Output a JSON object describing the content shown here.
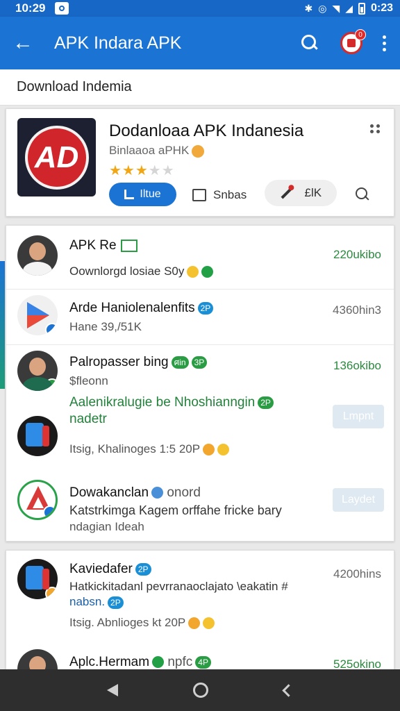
{
  "status": {
    "time_left": "10:29",
    "time_right": "0:23"
  },
  "appbar": {
    "title": "APK Indara APK",
    "badge": "0"
  },
  "subheader": {
    "text": "Download Indemia"
  },
  "featured": {
    "title": "Dodanloaa APK Indanesia",
    "subtitle": "Binlaaoa aPHK",
    "stars_on": "★★★",
    "stars_off": "★★",
    "install_label": "Iltue",
    "share_label": "Snbas",
    "tool_label": "£lK",
    "logo_text": "AD"
  },
  "items": [
    {
      "title": "APK Re",
      "sub": "Oownlorgd losiae S0y",
      "size": "220ukibo"
    },
    {
      "title": "Arde Haniolenalenfits",
      "pill": "2P",
      "sub": "Hane 39,/51K",
      "size": "4360hin3"
    },
    {
      "title": "Palropasser bing",
      "pill1": "ศin",
      "pill2": "3P",
      "sub": "$fleonn",
      "size": "136okibo"
    },
    {
      "title": "Aalenikralugie be Nhoshianngin",
      "title2": "nadetr",
      "pill": "2P",
      "sub": "Itsig, Khalinoges 1:5 20P",
      "btn": "Lmpnt"
    },
    {
      "title": "Dowakanclan",
      "tag": "onord",
      "sub": "Katstrkimga Kagem orffahe fricke bary",
      "sub2": "ndagian Ideah",
      "btn": "Laydet"
    },
    {
      "title": "Kaviedafer",
      "pill": "2P",
      "sub": "Hatkickitadanl pevrranaoclajato \\eakatin #",
      "sub2": "nabsn.",
      "sub3": "Itsig. Abnlioges kt 20P",
      "size": "4200hins"
    },
    {
      "title": "Aplc.Hermam",
      "tag": "npfc",
      "pill": "4P",
      "size": "525okino"
    }
  ]
}
